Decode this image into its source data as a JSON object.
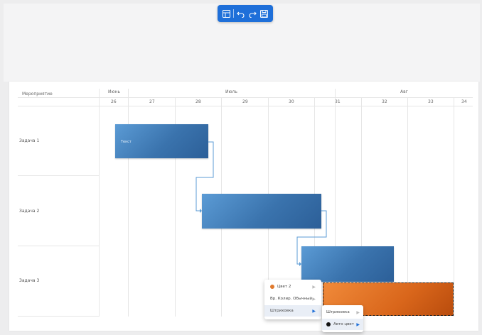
{
  "toolbar": {
    "icons": [
      "table-icon",
      "undo-icon",
      "redo-icon",
      "save-icon"
    ],
    "color": "#1e6fd9"
  },
  "gantt": {
    "column_header": "Мероприятие",
    "months": [
      "Июнь",
      "Июль",
      "Авг"
    ],
    "days": [
      "26",
      "27",
      "28",
      "29",
      "30",
      "31",
      "32",
      "33",
      "34"
    ],
    "tasks": [
      {
        "name": "Задача 1",
        "bar_label": "Текст"
      },
      {
        "name": "Задача 2",
        "bar_label": ""
      },
      {
        "name": "Задача 3",
        "bar_label": ""
      }
    ],
    "bar_color": "#3a73ad",
    "selected_bar_color": "#d9661b"
  },
  "context_menu": {
    "items": [
      {
        "label": "Цвет 2",
        "dot_color": "#e07a2e",
        "has_arrow": true
      },
      {
        "label": "Вр. Колир. Обычный",
        "has_arrow": true
      },
      {
        "label": "Штриховка",
        "has_arrow": true,
        "active": true
      }
    ],
    "submenu": {
      "items": [
        {
          "label": "Штриховка",
          "has_arrow": true
        },
        {
          "label": "Авто цвет",
          "dot_color": "#111111",
          "has_arrow": true,
          "active": true
        }
      ]
    }
  }
}
